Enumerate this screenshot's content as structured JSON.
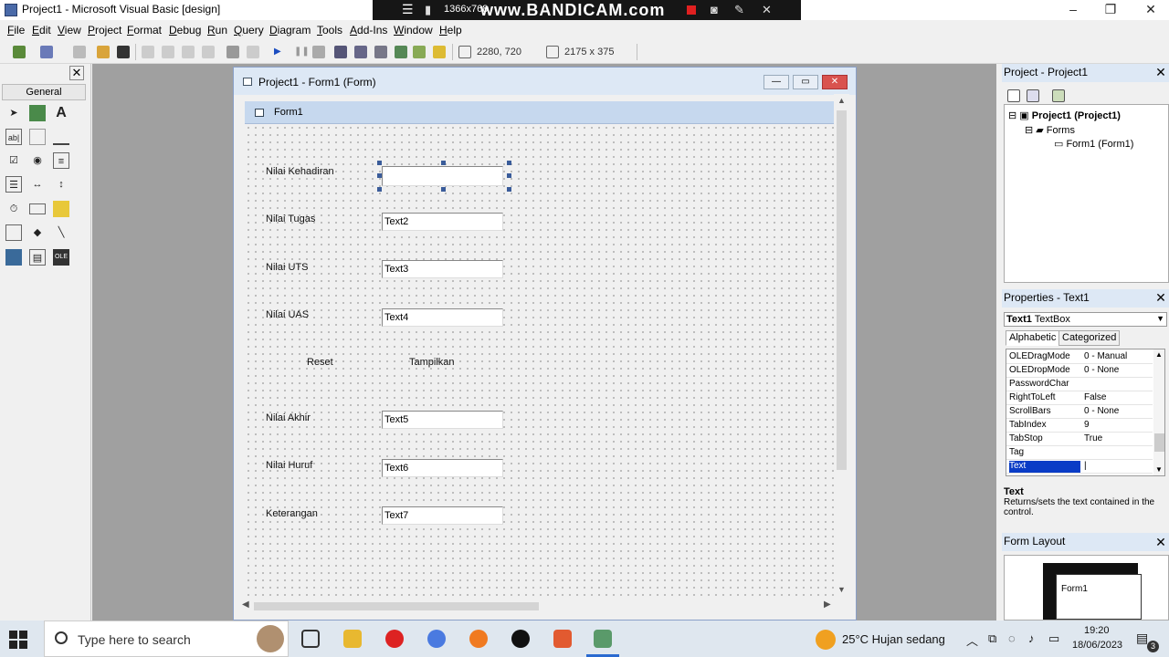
{
  "window": {
    "title": "Project1 - Microsoft Visual Basic [design]",
    "minimize": "–",
    "maximize": "❐",
    "close": "✕"
  },
  "recorder": {
    "resolution": "1366x768",
    "brand": "www.BANDICAM.com"
  },
  "menu": [
    "File",
    "Edit",
    "View",
    "Project",
    "Format",
    "Debug",
    "Run",
    "Query",
    "Diagram",
    "Tools",
    "Add-Ins",
    "Window",
    "Help"
  ],
  "toolbar": {
    "position": "2280, 720",
    "size": "2175 x 375"
  },
  "toolbox": {
    "close": "✕",
    "tab": "General"
  },
  "form_window": {
    "title": "Project1 - Form1 (Form)",
    "form_caption": "Form1"
  },
  "controls": {
    "lbl_kehadiran": "Nilai Kehadiran",
    "lbl_tugas": "Nilai Tugas",
    "txt2": "Text2",
    "lbl_uts": "Nilai UTS",
    "txt3": "Text3",
    "lbl_uas": "Nilai UAS",
    "txt4": "Text4",
    "btn_reset": "Reset",
    "btn_tampilkan": "Tampilkan",
    "lbl_akhir": "Nilai Akhir",
    "txt5": "Text5",
    "lbl_huruf": "Nilai Huruf",
    "txt6": "Text6",
    "lbl_keterangan": "Keterangan",
    "txt7": "Text7"
  },
  "project": {
    "header": "Project - Project1",
    "root": "Project1 (Project1)",
    "folder": "Forms",
    "item": "Form1 (Form1)"
  },
  "properties": {
    "header": "Properties - Text1",
    "object_name": "Text1",
    "object_type": "TextBox",
    "tab_alpha": "Alphabetic",
    "tab_cat": "Categorized",
    "rows": [
      {
        "name": "OLEDragMode",
        "value": "0 - Manual"
      },
      {
        "name": "OLEDropMode",
        "value": "0 - None"
      },
      {
        "name": "PasswordChar",
        "value": ""
      },
      {
        "name": "RightToLeft",
        "value": "False"
      },
      {
        "name": "ScrollBars",
        "value": "0 - None"
      },
      {
        "name": "TabIndex",
        "value": "9"
      },
      {
        "name": "TabStop",
        "value": "True"
      },
      {
        "name": "Tag",
        "value": ""
      },
      {
        "name": "Text",
        "value": "|"
      }
    ],
    "desc_title": "Text",
    "desc_text": "Returns/sets the text contained in the control."
  },
  "form_layout": {
    "header": "Form Layout",
    "form_label": "Form1"
  },
  "taskbar": {
    "search_placeholder": "Type here to search",
    "weather": "25°C  Hujan sedang",
    "time": "19:20",
    "date": "18/06/2023",
    "notifications": "3"
  }
}
